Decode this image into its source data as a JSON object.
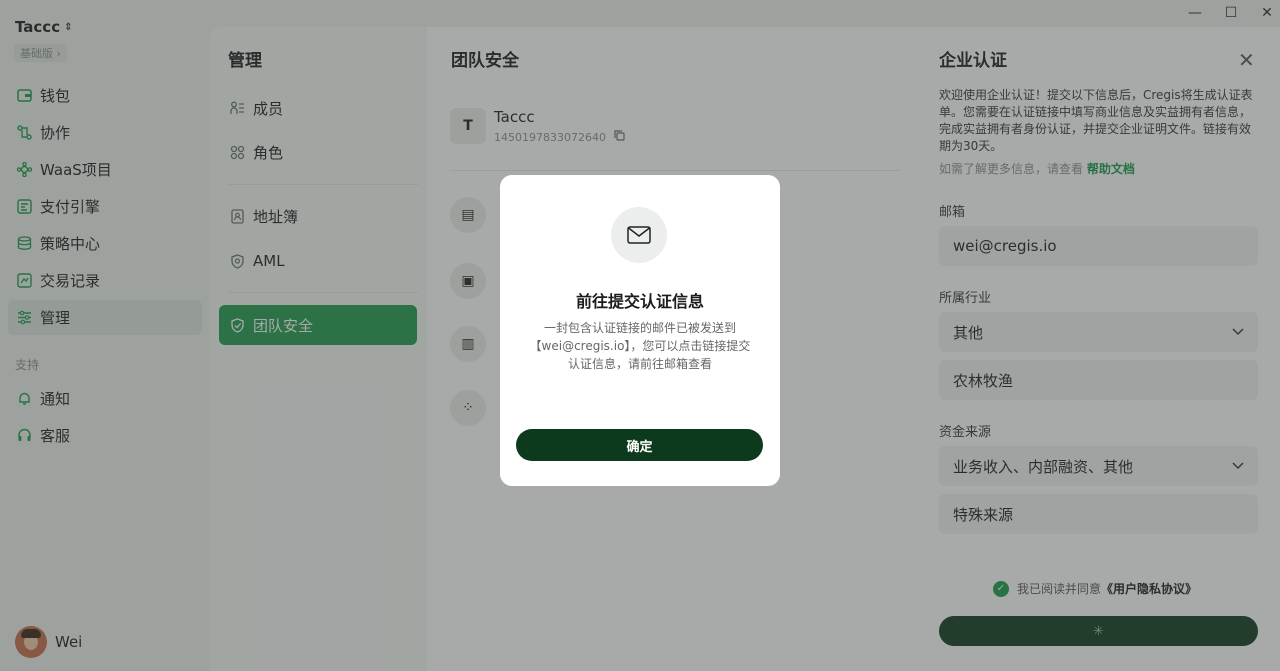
{
  "sidebar": {
    "brand": "Taccc",
    "plan": "基础版 ›",
    "items": [
      {
        "label": "钱包",
        "icon": "wallet-icon"
      },
      {
        "label": "协作",
        "icon": "collaboration-icon"
      },
      {
        "label": "WaaS项目",
        "icon": "waas-icon"
      },
      {
        "label": "支付引擎",
        "icon": "payment-engine-icon"
      },
      {
        "label": "策略中心",
        "icon": "policy-icon"
      },
      {
        "label": "交易记录",
        "icon": "transactions-icon"
      },
      {
        "label": "管理",
        "icon": "management-icon"
      }
    ],
    "support_section": "支持",
    "support_items": [
      {
        "label": "通知",
        "icon": "bell-icon"
      },
      {
        "label": "客服",
        "icon": "headset-icon"
      }
    ],
    "user_name": "Wei"
  },
  "management": {
    "title": "管理",
    "items": [
      {
        "label": "成员",
        "icon": "members-icon"
      },
      {
        "label": "角色",
        "icon": "roles-icon"
      },
      {
        "label": "地址簿",
        "icon": "address-book-icon"
      },
      {
        "label": "AML",
        "icon": "aml-shield-icon"
      },
      {
        "label": "团队安全",
        "icon": "team-security-icon"
      }
    ]
  },
  "team": {
    "title": "团队安全",
    "avatar_letter": "T",
    "name": "Taccc",
    "id": "1450197833072640"
  },
  "verify": {
    "title": "企业认证",
    "intro": "欢迎使用企业认证！提交以下信息后，Cregis将生成认证表单。您需要在认证链接中填写商业信息及实益拥有者信息，完成实益拥有者身份认证，并提交企业证明文件。链接有效期为30天。",
    "help_prefix": "如需了解更多信息，请查看",
    "help_link": "帮助文档",
    "email_label": "邮箱",
    "email_value": "wei@cregis.io",
    "industry_label": "所属行业",
    "industry_value": "其他",
    "industry_other": "农林牧渔",
    "funds_label": "资金来源",
    "funds_value": "业务收入、内部融资、其他",
    "funds_other": "特殊来源",
    "agree_prefix": "我已阅读并同意",
    "agree_link": "《用户隐私协议》"
  },
  "modal": {
    "title": "前往提交认证信息",
    "message": "一封包含认证链接的邮件已被发送到【wei@cregis.io】，您可以点击链接提交认证信息，请前往邮箱查看",
    "confirm": "确定"
  },
  "colors": {
    "accent": "#1f9a4e",
    "dark_button": "#0d3a1c"
  }
}
